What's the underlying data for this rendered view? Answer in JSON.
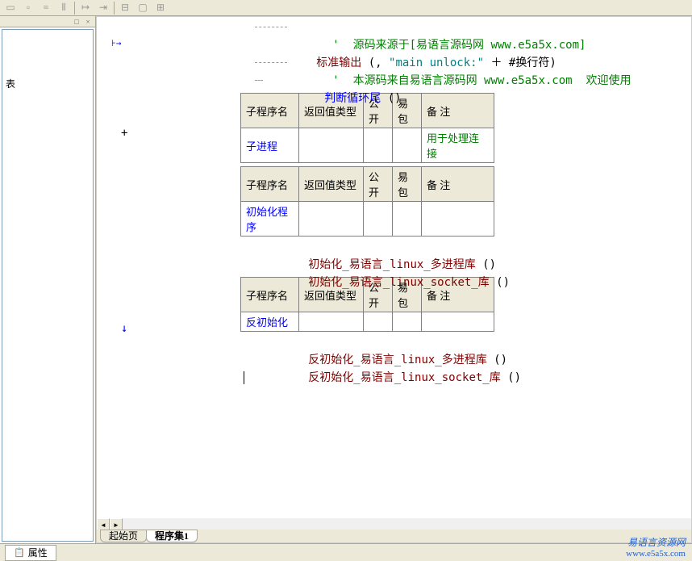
{
  "toolbar": {
    "buttons": [
      "b1",
      "b2",
      "b3",
      "b4",
      "b5",
      "b6",
      "b7",
      "b8",
      "b9"
    ]
  },
  "sidebar": {
    "close": "×",
    "pin": "□",
    "item": "表"
  },
  "gutter": {
    "plus": "+",
    "down_arrow": "↓",
    "branch": "⊦→"
  },
  "code": {
    "line1_comment": "'  源码来源于[易语言源码网 www.e5a5x.com]",
    "line2_func": "标准输出",
    "line2_paren_open": " (",
    "line2_comma": ", ",
    "line2_str": "\"main unlock:\"",
    "line2_plus": " ＋ ",
    "line2_const": "#换行符",
    "line2_paren_close": ")",
    "line3_comment": "'  本源码来自易语言源码网 www.e5a5x.com  欢迎使用",
    "line4_func": "判断循环尾",
    "line4_paren": " ()",
    "call1": "初始化_易语言_linux_多进程库",
    "call_paren": " ()",
    "call2": "初始化_易语言_linux_socket_库",
    "call3": "反初始化_易语言_linux_多进程库",
    "call4": "反初始化_易语言_linux_socket_库"
  },
  "table_headers": {
    "name": "子程序名",
    "ret": "返回值类型",
    "pub": "公开",
    "pkg": "易包",
    "note": "备 注"
  },
  "table1": {
    "name": "子进程",
    "note": "用于处理连接"
  },
  "table2": {
    "name": "初始化程序"
  },
  "table3": {
    "name": "反初始化"
  },
  "tabs": {
    "start": "起始页",
    "prog": "程序集1"
  },
  "bottom": {
    "prop": "属性"
  },
  "watermark": {
    "l1": "易语言资源网",
    "l2": "www.e5a5x.com"
  }
}
